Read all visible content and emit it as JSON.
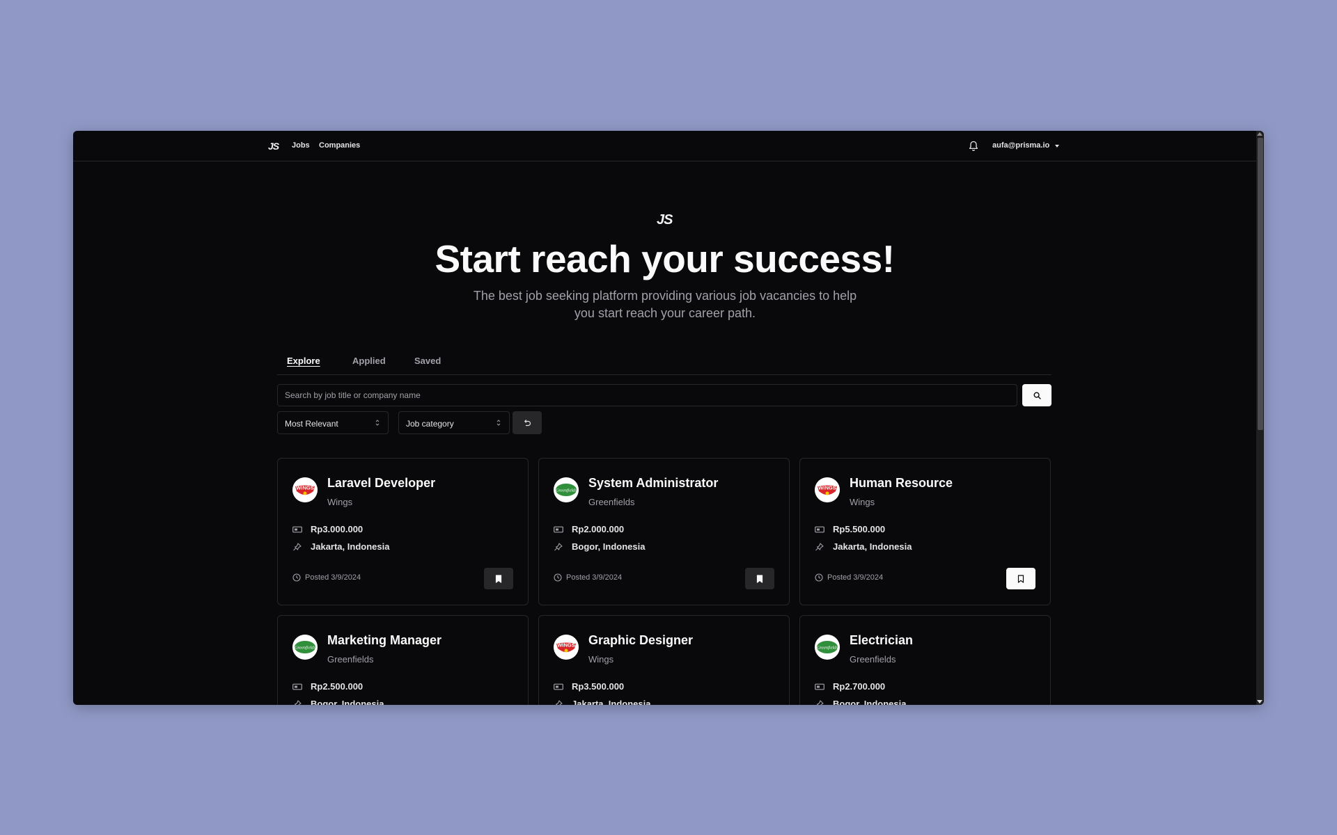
{
  "nav": {
    "logo": "JS",
    "links": [
      "Jobs",
      "Companies"
    ],
    "user_email": "aufa@prisma.io"
  },
  "hero": {
    "logo": "JS",
    "title": "Start reach your success!",
    "subtitle": "The best job seeking platform providing various job vacancies to help you start reach your career path."
  },
  "tabs": [
    "Explore",
    "Applied",
    "Saved"
  ],
  "active_tab": "Explore",
  "search": {
    "placeholder": "Search by job title or company name"
  },
  "filters": {
    "sort_value": "Most Relevant",
    "category_value": "Job category"
  },
  "jobs": [
    {
      "title": "Laravel Developer",
      "company": "Wings",
      "salary": "Rp3.000.000",
      "location": "Jakarta, Indonesia",
      "posted": "Posted 3/9/2024",
      "saved": true,
      "logo": "wings"
    },
    {
      "title": "System Administrator",
      "company": "Greenfields",
      "salary": "Rp2.000.000",
      "location": "Bogor, Indonesia",
      "posted": "Posted 3/9/2024",
      "saved": true,
      "logo": "greenfields"
    },
    {
      "title": "Human Resource",
      "company": "Wings",
      "salary": "Rp5.500.000",
      "location": "Jakarta, Indonesia",
      "posted": "Posted 3/9/2024",
      "saved": false,
      "logo": "wings"
    },
    {
      "title": "Marketing Manager",
      "company": "Greenfields",
      "salary": "Rp2.500.000",
      "location": "Bogor, Indonesia",
      "posted": "",
      "saved": false,
      "logo": "greenfields"
    },
    {
      "title": "Graphic Designer",
      "company": "Wings",
      "salary": "Rp3.500.000",
      "location": "Jakarta, Indonesia",
      "posted": "",
      "saved": false,
      "logo": "wings"
    },
    {
      "title": "Electrician",
      "company": "Greenfields",
      "salary": "Rp2.700.000",
      "location": "Bogor, Indonesia",
      "posted": "",
      "saved": false,
      "logo": "greenfields"
    }
  ],
  "colors": {
    "backdrop": "#9099c6",
    "app_bg": "#09090b",
    "border": "#27272a",
    "muted_text": "#a1a1aa",
    "primary_text": "#fafafa",
    "wings_red": "#d7262b",
    "greenfields_green": "#2f8f3a"
  }
}
